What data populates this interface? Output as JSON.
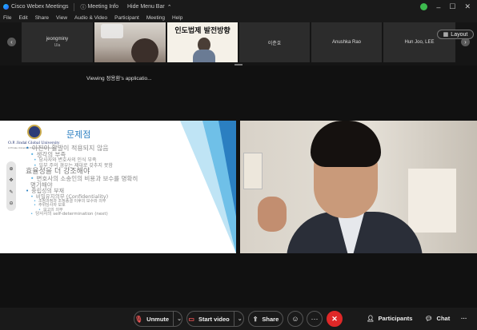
{
  "titlebar": {
    "app_name": "Cisco Webex Meetings",
    "meeting_info": "Meeting Info",
    "hide_menu_bar": "Hide Menu Bar",
    "minimize": "–",
    "maximize": "☐",
    "close": "✕"
  },
  "menu": {
    "items": [
      "File",
      "Edit",
      "Share",
      "View",
      "Audio & Video",
      "Participant",
      "Meeting",
      "Help"
    ]
  },
  "strip": {
    "tiles": [
      {
        "name": "jeongminy",
        "sub": "Ula"
      },
      {
        "name": "",
        "sub": ""
      },
      {
        "name": "",
        "sub": ""
      },
      {
        "name": "이춘호",
        "sub": ""
      },
      {
        "name": "Anushka Rao",
        "sub": ""
      },
      {
        "name": "Hun Joo, LEE",
        "sub": ""
      }
    ],
    "tile3_banner": "인도법제 발전방향",
    "layout_label": "Layout"
  },
  "viewing_text": "Viewing 정용환's applicatio...",
  "slide": {
    "university": "O.P. Jindal Global University",
    "university_sub": "A Private University Promoting Public Service",
    "title": "문제점",
    "lines": [
      "이진이 활발이 적용되지 않음",
      "생각의 부족",
      "당사자와 변호사의 인식 부족",
      "일부 주의 경우는 제대로 갖추지 못함",
      "효율성을 더 강조해야",
      "변호사의 소송인의 비용과 보수를 명확히",
      "명기해야",
      "중립성의 부재",
      "비밀유지의무 (Confidentiality)",
      "조정과정과 조정종결 이후의 보수와 의무",
      "주위당사자 보호",
      "보고의 의무",
      "당사자의 self-determination (next)"
    ]
  },
  "controls": {
    "unmute": "Unmute",
    "start_video": "Start video",
    "share": "Share",
    "reactions_icon": "emoji-icon",
    "more": "···",
    "end": "✕",
    "participants": "Participants",
    "chat": "Chat",
    "overflow": "···"
  },
  "colors": {
    "accent_blue": "#2b7fc1",
    "end_red": "#e02828",
    "green_status": "#3dba4e"
  }
}
